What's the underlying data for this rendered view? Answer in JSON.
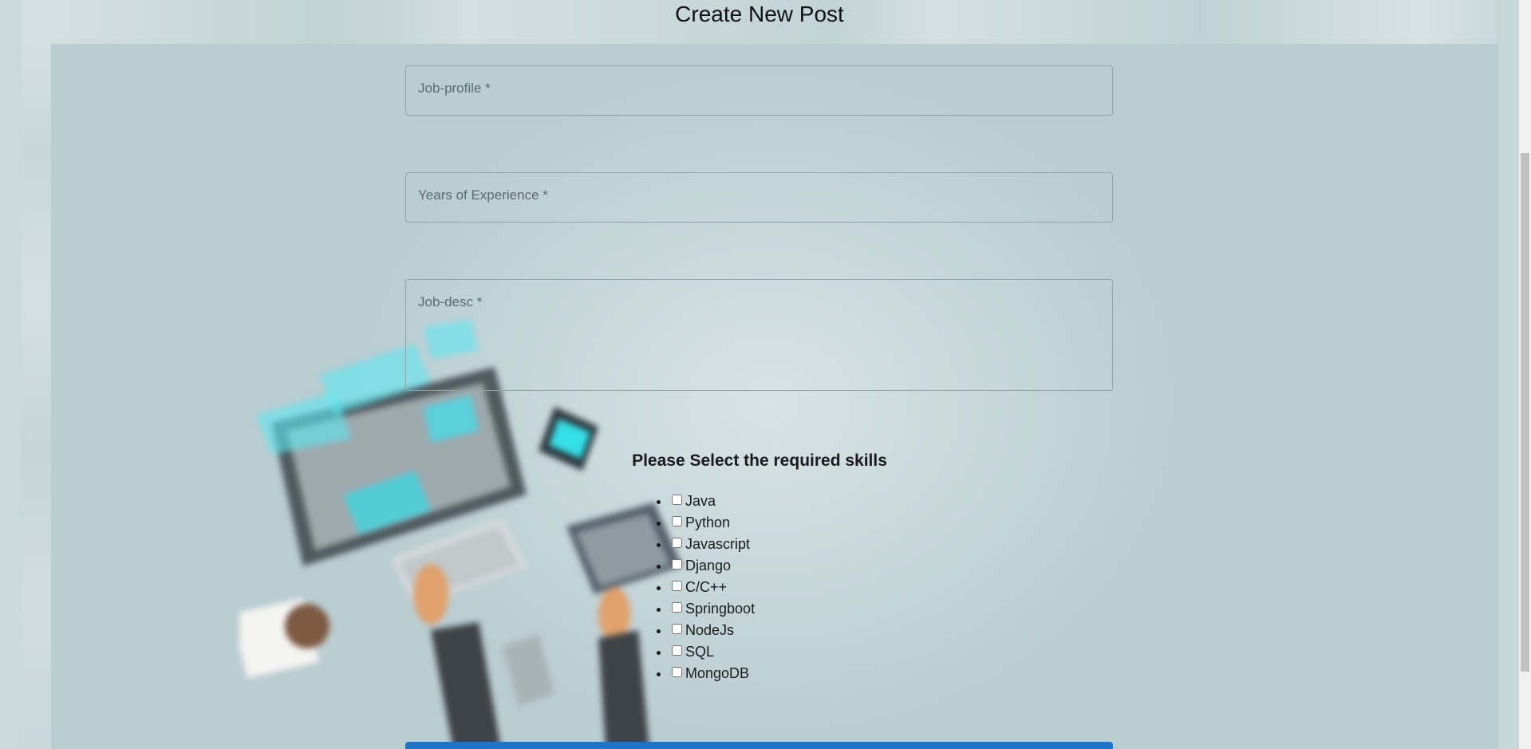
{
  "page": {
    "title": "Create New Post"
  },
  "form": {
    "job_profile_label": "Job-profile *",
    "experience_label": "Years of Experience *",
    "job_desc_label": "Job-desc *"
  },
  "skills": {
    "heading": "Please Select the required skills",
    "items": [
      {
        "label": "Java",
        "checked": false
      },
      {
        "label": "Python",
        "checked": false
      },
      {
        "label": "Javascript",
        "checked": false
      },
      {
        "label": "Django",
        "checked": false
      },
      {
        "label": "C/C++",
        "checked": false
      },
      {
        "label": "Springboot",
        "checked": false
      },
      {
        "label": "NodeJs",
        "checked": false
      },
      {
        "label": "SQL",
        "checked": false
      },
      {
        "label": "MongoDB",
        "checked": false
      }
    ]
  },
  "colors": {
    "accent": "#1f74c9",
    "background": "#bccfd3"
  }
}
